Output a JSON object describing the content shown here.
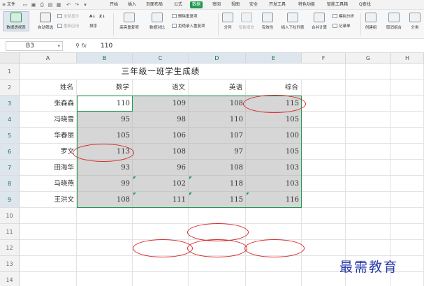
{
  "menu": {
    "file_label": "文件",
    "tabs": [
      "开始",
      "插入",
      "页面布局",
      "公式",
      "数据",
      "审阅",
      "视图",
      "安全",
      "开发工具",
      "特色功能",
      "智能工具箱"
    ],
    "active_tab": "数据",
    "search_label": "Q查找"
  },
  "ribbon": {
    "pivot": "数据透视表",
    "autofilter": "自动筛选",
    "show_all": "全部显示",
    "reapply": "重新应用",
    "sort_az": "A↓",
    "sort_za": "Z↓",
    "sort": "排序",
    "highlight_dup": "高亮重复项",
    "data_compare": "数据对比",
    "delete_dup": "删除重复项",
    "reject_dup": "拒绝录入重复项",
    "split": "分列",
    "smart_fill": "智能填充",
    "validity": "有效性",
    "dropdown": "插入下拉列表",
    "merge_calc": "合并计算",
    "simulation": "模拟分析",
    "record": "记录单",
    "create_group": "创建组",
    "ungroup": "取消组合",
    "subtotal": "分类"
  },
  "formula_bar": {
    "cell_ref": "B3",
    "fx_label": "fx",
    "value": "110"
  },
  "sheet": {
    "columns": [
      "A",
      "B",
      "C",
      "D",
      "E",
      "F",
      "G",
      "H"
    ],
    "rows": [
      "1",
      "2",
      "3",
      "4",
      "5",
      "6",
      "7",
      "8",
      "9",
      "10",
      "11",
      "12",
      "13",
      "14"
    ],
    "title": "三年级一班学生成绩",
    "headers": [
      "姓名",
      "数学",
      "语文",
      "英语",
      "综合"
    ],
    "students": [
      {
        "name": "张森森",
        "scores": [
          110,
          109,
          108,
          115
        ]
      },
      {
        "name": "冯晓雪",
        "scores": [
          95,
          98,
          110,
          105
        ]
      },
      {
        "name": "华春丽",
        "scores": [
          105,
          106,
          107,
          100
        ]
      },
      {
        "name": "罗文",
        "scores": [
          113,
          108,
          97,
          105
        ]
      },
      {
        "name": "田海华",
        "scores": [
          93,
          96,
          108,
          103
        ]
      },
      {
        "name": "马晓燕",
        "scores": [
          99,
          102,
          118,
          103
        ]
      },
      {
        "name": "王洪文",
        "scores": [
          108,
          111,
          115,
          116
        ]
      }
    ],
    "selected_cell": "B3"
  },
  "colors": {
    "accent": "#1e9a4f",
    "highlight_gray": "#d6d6d6",
    "annotation_red": "#d6292b",
    "watermark_blue": "#2a3ba8"
  },
  "watermark": "最需教育"
}
